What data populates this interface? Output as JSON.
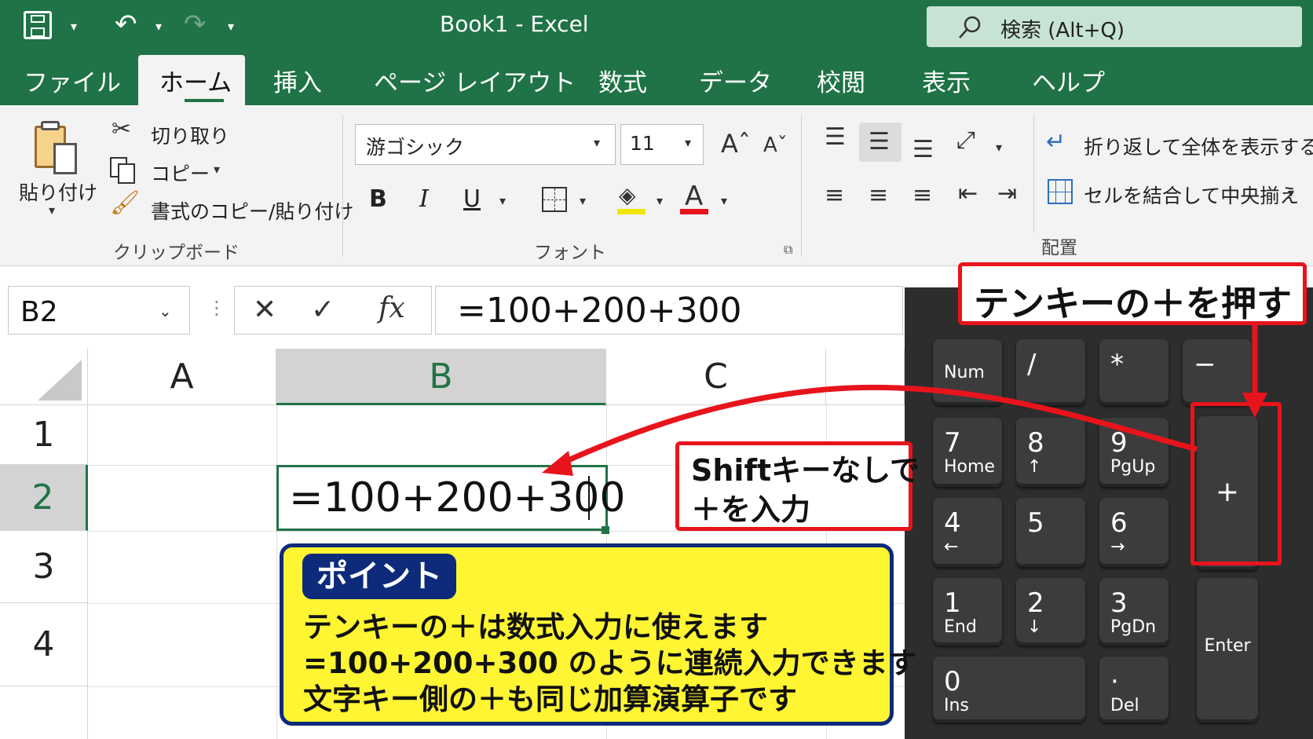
{
  "titlebar": {
    "save_icon": "save-icon",
    "undo_icon": "undo-icon",
    "redo_icon": "redo-icon",
    "doc_title": "Book1  -  Excel",
    "search_placeholder": "検索 (Alt+Q)"
  },
  "tabs": [
    {
      "label": "ファイル"
    },
    {
      "label": "ホーム",
      "active": true
    },
    {
      "label": "挿入"
    },
    {
      "label": "ページ レイアウト"
    },
    {
      "label": "数式"
    },
    {
      "label": "データ"
    },
    {
      "label": "校閲"
    },
    {
      "label": "表示"
    },
    {
      "label": "ヘルプ"
    }
  ],
  "ribbon": {
    "clipboard": {
      "paste": "貼り付け",
      "cut": "切り取り",
      "copy": "コピー",
      "format_painter": "書式のコピー/貼り付け",
      "group_label": "クリップボード"
    },
    "font": {
      "font_name": "游ゴシック",
      "font_size": "11",
      "bold": "B",
      "italic": "I",
      "underline": "U",
      "group_label": "フォント",
      "highlight_color": "#f2e600",
      "font_color": "#e8141c"
    },
    "alignment": {
      "wrap_text": "折り返して全体を表示する",
      "merge_center": "セルを結合して中央揃え",
      "group_label": "配置"
    }
  },
  "formula_bar": {
    "name_box": "B2",
    "cancel": "✕",
    "enter": "✓",
    "fx": "fx",
    "formula": "=100+200+300"
  },
  "grid": {
    "columns": [
      "A",
      "B",
      "C"
    ],
    "rows": [
      "1",
      "2",
      "3",
      "4"
    ],
    "active_cell_value": "=100+200+300"
  },
  "callouts": {
    "top": "テンキーの＋を押す",
    "middle_line1": "Shiftキーなしで",
    "middle_line2": "＋を入力"
  },
  "point": {
    "badge": "ポイント",
    "lines": [
      "テンキーの＋は数式入力に使えます",
      "=100+200+300 のように連続入力できます",
      "文字キー側の＋も同じ加算演算子です"
    ]
  },
  "keypad": {
    "num": "Num",
    "slash": "/",
    "star": "*",
    "minus": "−",
    "plus": "+",
    "k7": "7",
    "k7s": "Home",
    "k8": "8",
    "k8s": "↑",
    "k9": "9",
    "k9s": "PgUp",
    "k4": "4",
    "k4s": "←",
    "k5": "5",
    "k6": "6",
    "k6s": "→",
    "k1": "1",
    "k1s": "End",
    "k2": "2",
    "k2s": "↓",
    "k3": "3",
    "k3s": "PgDn",
    "k0": "0",
    "k0s": "Ins",
    "dot": "·",
    "dots": "Del",
    "enter": "Enter"
  },
  "colors": {
    "excel_green": "#1f7346",
    "callout_red": "#e8141c",
    "point_yellow": "#fff533",
    "point_navy": "#0d2b7a"
  }
}
